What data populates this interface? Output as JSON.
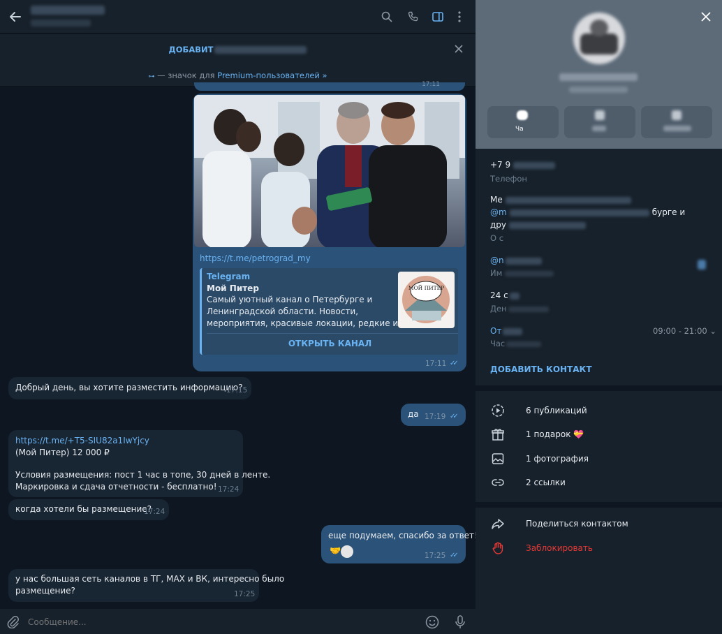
{
  "header": {
    "back_icon": "arrow-left-icon",
    "icons": [
      "search-icon",
      "phone-icon",
      "sidebar-toggle-icon",
      "more-vertical-icon"
    ]
  },
  "promo": {
    "title": "ДОБАВИТ",
    "sub_prefix": "— значок для ",
    "sub_link": "Premium-пользователей »"
  },
  "messages": {
    "link_url": "https://t.me/petrograd_my",
    "preview_site": "Telegram",
    "preview_title": "Мой Питер",
    "preview_line1": "Самый уютный канал о Петербурге и",
    "preview_line2": "Ленинградской области. Новости,",
    "preview_line3": "мероприятия, красивые локации, редкие и у...",
    "preview_button": "ОТКРЫТЬ КАНАЛ",
    "preview_logo": "МОЙ ПИТЕР",
    "time_1": "17:11",
    "time_top": "17:11",
    "m2_text": "Добрый день, вы хотите разместить информацию?",
    "m2_time": "17:15",
    "m3_text": "да",
    "m3_time": "17:19",
    "m4_link": "https://t.me/+T5-SIU82a1IwYjcy",
    "m4_line2": "(Мой Питер) 12 000 ₽",
    "m4_line3": "Условия размещения: пост 1 час в топе, 30 дней в ленте.",
    "m4_line4": "Маркировка и сдача отчетности - бесплатно!",
    "m4_time": "17:24",
    "m5_text": "когда хотели бы размещение?",
    "m5_time": "17:24",
    "m6_text": "еще подумаем, спасибо за ответ!",
    "m6_time": "17:25",
    "m7_line1": "у нас большая сеть каналов в ТГ, MAX и ВК, интересно было",
    "m7_line2": "размещение?",
    "m7_time": "17:25"
  },
  "composer": {
    "placeholder": "Сообщение...",
    "icons": [
      "attach-icon",
      "emoji-icon",
      "microphone-icon"
    ]
  },
  "panel": {
    "close_icon": "close-icon",
    "action_label": "Ча",
    "phone_value": "+7 9",
    "phone_label": "Телефон",
    "bio_line1": "Ме",
    "bio_line2_link": "@m",
    "bio_line2_tail": "бурге и",
    "bio_line3": "дру",
    "bio_label": "О с",
    "username_value": "@n",
    "username_label": "Им",
    "birthday_value": "24 с",
    "birthday_label": "Ден",
    "hours_value": "От",
    "hours_range": "09:00 - 21:00",
    "hours_label": "Час",
    "add_contact": "ДОБАВИТЬ КОНТАКТ",
    "rows": [
      {
        "icon": "stories-icon",
        "label": "6 публикаций"
      },
      {
        "icon": "gift-icon",
        "label": "1 подарок"
      },
      {
        "icon": "photo-icon",
        "label": "1 фотография"
      },
      {
        "icon": "link-icon",
        "label": "2 ссылки"
      }
    ],
    "share_label": "Поделиться контактом",
    "block_label": "Заблокировать"
  },
  "colors": {
    "accent": "#6ab3f3",
    "danger": "#e53935",
    "bubble_out": "#2b5278",
    "bubble_in": "#182533",
    "background": "#0e1621"
  }
}
